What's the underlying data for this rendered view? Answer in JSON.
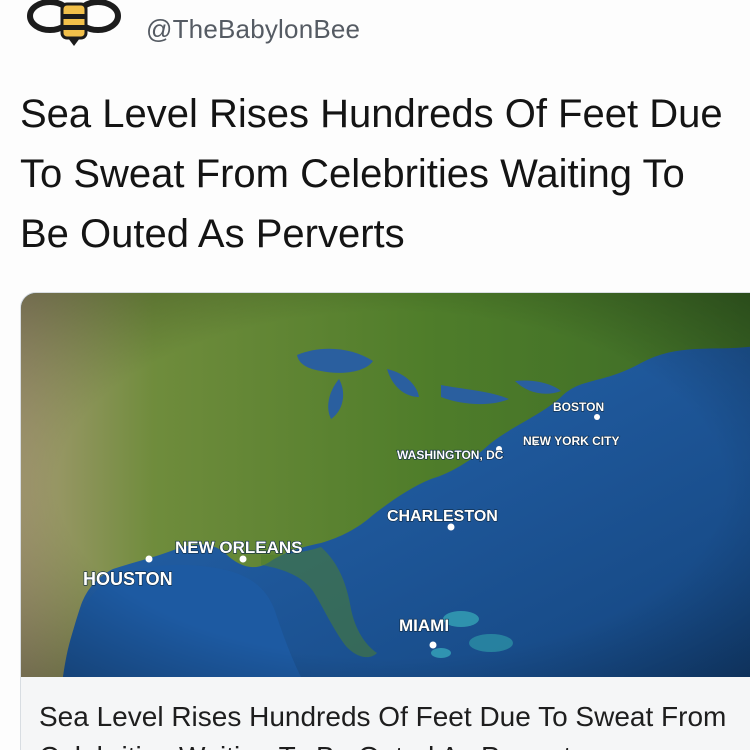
{
  "header": {
    "handle": "@TheBabylonBee",
    "avatar_icon": "bee-logo-icon",
    "colors": {
      "bee_yellow": "#f2c04a",
      "bee_dark": "#1c1c1c"
    }
  },
  "headline": "Sea Level Rises Hundreds Of Feet Due To Sweat From Celebrities Waiting To Be Outed As Perverts",
  "link_card": {
    "caption": "Sea Level Rises Hundreds Of Feet Due To Sweat From Celebrities Waiting To Be Outed As Perverts",
    "map_cities": {
      "boston": "BOSTON",
      "new_york_city": "NEW YORK CITY",
      "washington_dc": "WASHINGTON, DC",
      "charleston": "CHARLESTON",
      "new_orleans": "NEW ORLEANS",
      "houston": "HOUSTON",
      "miami": "MIAMI"
    },
    "colors": {
      "ocean": "#1f5ea8",
      "land": "#5e8a2e"
    }
  }
}
